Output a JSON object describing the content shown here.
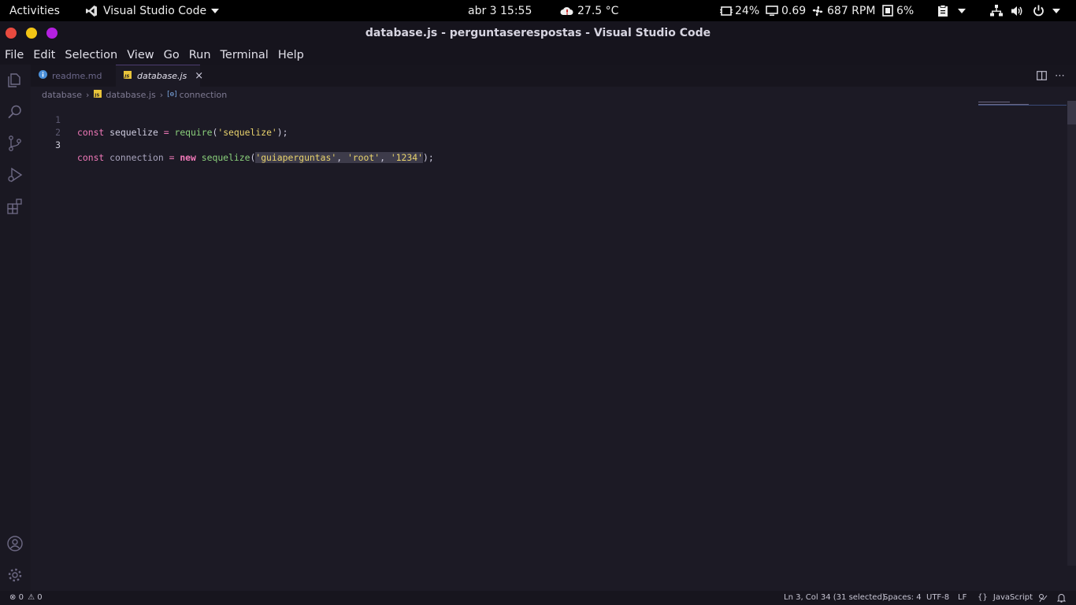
{
  "topbar": {
    "activities": "Activities",
    "app_name": "Visual Studio Code",
    "clock": "abr 3  15:55",
    "weather": "27.5 °C",
    "cpu": "24%",
    "load": "0.69",
    "fan": "687 RPM",
    "memory": "6%"
  },
  "window": {
    "title": "database.js - perguntaserespostas - Visual Studio Code",
    "close_color": "#e84a3f",
    "minimize_color": "#f3c515",
    "maximize_color": "#b420e0"
  },
  "menu": [
    "File",
    "Edit",
    "Selection",
    "View",
    "Go",
    "Run",
    "Terminal",
    "Help"
  ],
  "tabs": [
    {
      "label": "readme.md",
      "icon": "info-icon"
    },
    {
      "label": "database.js",
      "icon": "js-file-icon",
      "active": true
    }
  ],
  "breadcrumb": {
    "folder": "database",
    "file": "database.js",
    "symbol": "connection"
  },
  "editor": {
    "line_numbers": [
      "1",
      "2",
      "3"
    ],
    "line1": {
      "kw": "const",
      "name": "sequelize",
      "eq": "=",
      "fn": "require",
      "open": "(",
      "arg": "'sequelize'",
      "close": ");"
    },
    "line3": {
      "kw": "const",
      "name": "connection",
      "eq": "=",
      "new": "new",
      "fn": "sequelize",
      "open": "(",
      "arg1": "'guiaperguntas'",
      "sep1": ", ",
      "arg2": "'root'",
      "sep2": ", ",
      "arg3": "'1234'",
      "close": ");"
    }
  },
  "status": {
    "errors": "0",
    "warnings": "0",
    "position": "Ln 3, Col 34 (31 selected)",
    "spaces": "Spaces: 4",
    "encoding": "UTF-8",
    "eol": "LF",
    "language": "JavaScript"
  },
  "colors": {
    "keyword": "#f078b8",
    "string": "#e9d36c",
    "function": "#8ad07b",
    "background": "#1c1a25"
  }
}
